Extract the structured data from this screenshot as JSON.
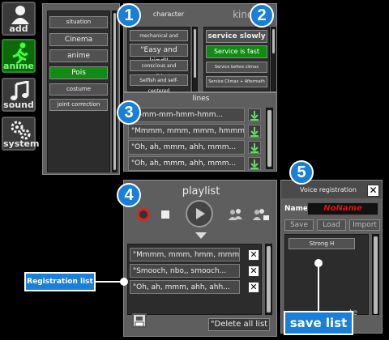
{
  "sidebar": [
    {
      "label": "add",
      "icon": "person-add-icon",
      "active": false
    },
    {
      "label": "anime",
      "icon": "running-figure-icon",
      "active": true
    },
    {
      "label": "sound",
      "icon": "music-note-icon",
      "active": false
    },
    {
      "label": "system",
      "icon": "gears-icon",
      "active": false
    }
  ],
  "categories": {
    "items": [
      "situation",
      "Cinema",
      "anime",
      "Pois",
      "costume",
      "joint correction"
    ],
    "selected_index": 3
  },
  "character": {
    "title": "character",
    "options": [
      "mechanical and emotionless",
      "\"Easy and kind\"",
      "conscious and confident",
      "Selfish and self-centered"
    ]
  },
  "kinds": {
    "title": "kinds",
    "options": [
      "service slowly",
      "Service is fast",
      "Service before climax",
      "Service Climax + Aftermath"
    ],
    "selected_index": 1
  },
  "lines": {
    "title": "lines",
    "items": [
      "\"R-mm-mm-hmm-hmm...",
      "\"Mmmm, mmm, mmm, hmmm...",
      "\"Oh, ah, mmm, ahh, mmm...",
      "\"Oh, ah, mmm, ahh, mmm..."
    ]
  },
  "playlist": {
    "title": "playlist",
    "items": [
      "\"Mmmm, mmm, hmm, mmm, ri...",
      "\"Smooch, nbo,, smooch...",
      "\"Oh, ah, mmm, ahh, ahh..."
    ],
    "delete_all_label": "\"Delete all list"
  },
  "voice_registration": {
    "title": "Voice registration",
    "name_label": "Name",
    "name_value": "NoName",
    "save_label": "Save",
    "load_label": "Load",
    "import_label": "Import",
    "entries": [
      "Strong H"
    ],
    "bottom_fragment": "te"
  },
  "annotations": {
    "badges": [
      "1",
      "2",
      "3",
      "4",
      "5"
    ],
    "registration_list": "Registration list",
    "save_list": "save list"
  },
  "colors": {
    "accent_blue": "#1a7fd9",
    "selected_green": "#138a13",
    "name_red": "#e01010"
  }
}
